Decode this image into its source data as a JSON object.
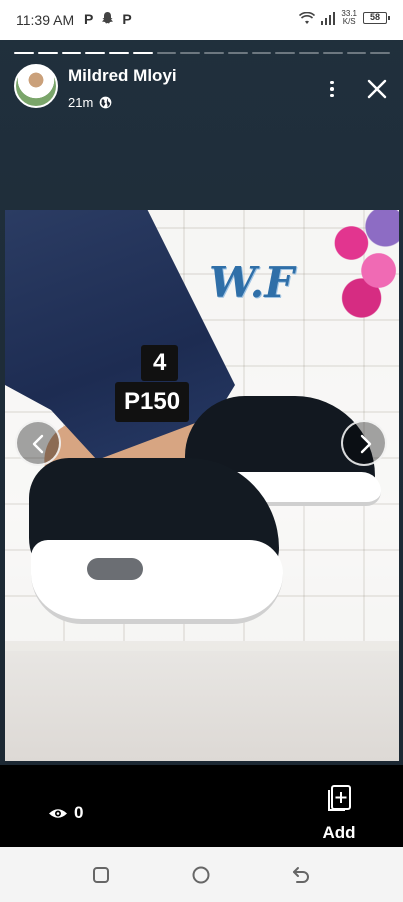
{
  "status_bar": {
    "time": "11:39 AM",
    "notification_icons": [
      "P",
      "snapchat-icon",
      "P"
    ],
    "net_speed": "33.1",
    "net_speed_unit": "K/S",
    "battery": "58"
  },
  "story": {
    "segments_total": 16,
    "segments_viewed": 6
  },
  "header": {
    "author": "Mildred Mloyi",
    "time_ago": "21m",
    "privacy_icon": "globe-icon"
  },
  "post": {
    "watermark": "W.F",
    "item_number": "4",
    "price": "P150"
  },
  "footer": {
    "view_count": "0",
    "add_label": "Add"
  },
  "colors": {
    "background": "#1f2833",
    "bottom_bar": "#000000",
    "watermark": "#2f6fa8"
  }
}
